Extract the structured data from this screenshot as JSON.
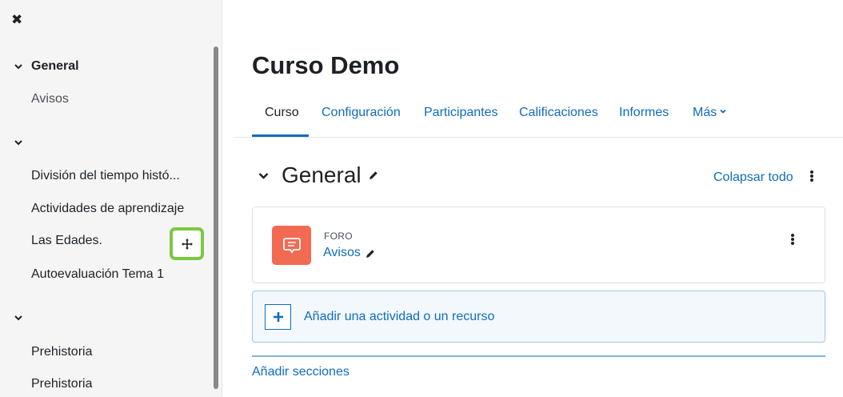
{
  "sidebar": {
    "close_icon": "close-icon",
    "sections": [
      {
        "title": "General",
        "items": [
          "Avisos"
        ]
      },
      {
        "title": "",
        "items": [
          "División del tiempo histó...",
          "Actividades de aprendizaje",
          "Las Edades.",
          "Autoevaluación Tema 1"
        ]
      },
      {
        "title": "",
        "items": [
          "Prehistoria",
          "Prehistoria"
        ]
      }
    ],
    "move_icon": "move-icon"
  },
  "course": {
    "title": "Curso Demo",
    "tabs": [
      {
        "label": "Curso",
        "active": true
      },
      {
        "label": "Configuración"
      },
      {
        "label": "Participantes"
      },
      {
        "label": "Calificaciones"
      },
      {
        "label": "Informes"
      },
      {
        "label": "Más"
      }
    ]
  },
  "section": {
    "title": "General",
    "collapse_all": "Colapsar todo",
    "activity": {
      "type": "FORO",
      "name": "Avisos",
      "icon": "forum-icon"
    },
    "add_activity": "Añadir una actividad o un recurso",
    "add_sections": "Añadir secciones"
  },
  "colors": {
    "link": "#0f6cbf",
    "forum_icon_bg": "#f26a52",
    "highlight_border": "#7ac943",
    "sidebar_bg": "#f5f5f5"
  }
}
